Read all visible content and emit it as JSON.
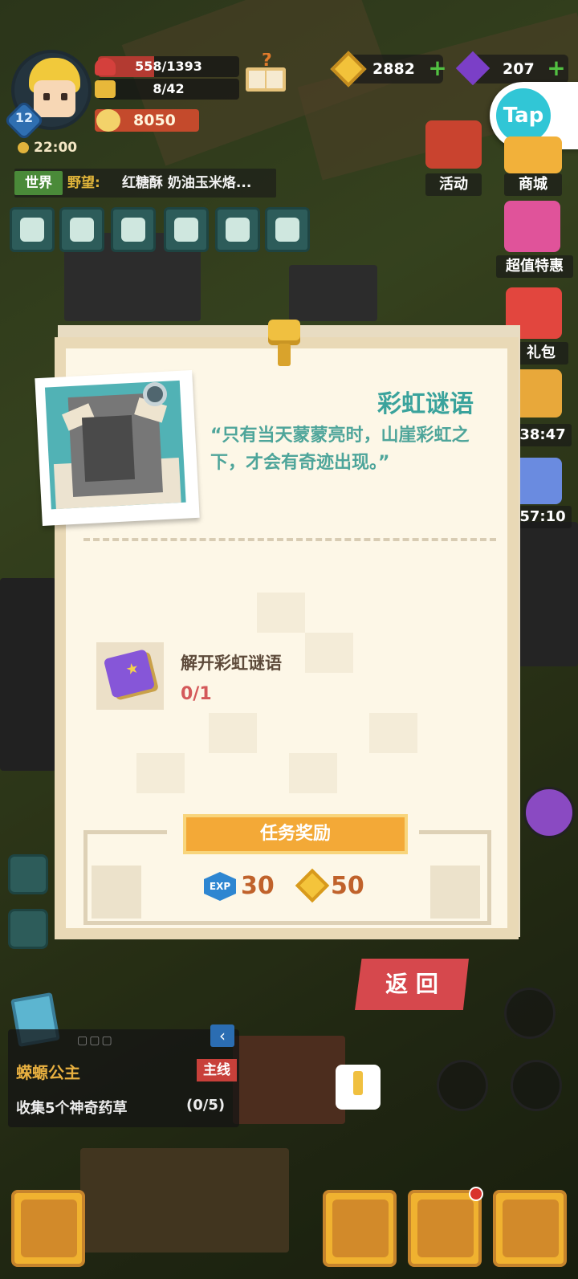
{
  "hud": {
    "hp": "558/1393",
    "hp_ratio": 0.4,
    "energy": "8/42",
    "power": "8050",
    "timer": "22:00",
    "level": "12"
  },
  "currency": {
    "gold": "2882",
    "gems": "207"
  },
  "tap_label": "Tap",
  "chat": {
    "channel": "世界",
    "name": "野望:",
    "message": "红糖酥 奶油玉米烙..."
  },
  "side_menu": {
    "activity": "活动",
    "shop": "商城",
    "deals": "超值特惠",
    "gift": "礼包",
    "timer1": "38:47",
    "timer2": "57:10"
  },
  "modal": {
    "title": "彩虹谜语",
    "quote": "“只有当天蒙蒙亮时，山崖彩虹之下，才会有奇迹出现。”",
    "task_name": "解开彩虹谜语",
    "task_progress": "0/1",
    "reward_banner": "任务奖励",
    "exp_label": "EXP",
    "exp_value": "30",
    "gold_value": "50",
    "back_button": "返 回"
  },
  "quest": {
    "dots": "▢▢▢",
    "title": "蝾螈公主",
    "tag": "主线",
    "desc": "收集5个神奇药草",
    "count": "(0/5)",
    "collapse_icon": "‹"
  },
  "colors": {
    "accent_teal": "#3aa39c",
    "reward_orange": "#f3a937",
    "back_red": "#d6484d"
  }
}
